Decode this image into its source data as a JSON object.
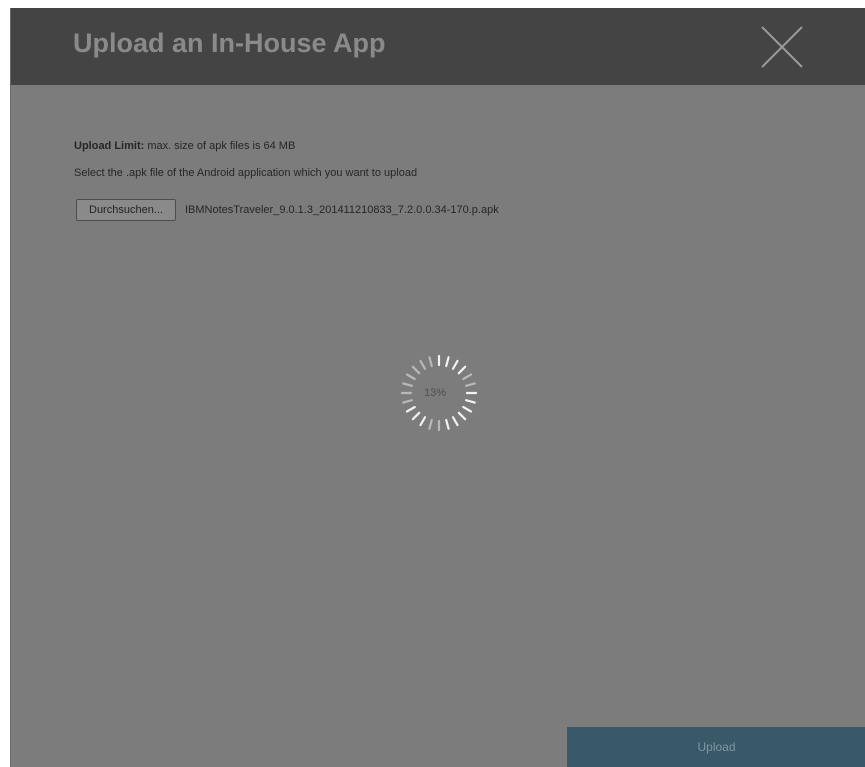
{
  "dialog": {
    "title": "Upload an In-House App",
    "close_icon": "close-x-icon",
    "upload_limit_label": "Upload Limit:",
    "upload_limit_text": "max. size of apk files is 64 MB",
    "instruction": "Select the .apk file of the Android application which you want to upload",
    "browse_label": "Durchsuchen...",
    "selected_file": "IBMNotesTraveler_9.0.1.3_201411210833_7.2.0.0.34-170.p.apk",
    "progress_text": "13%",
    "progress_value": 13,
    "spinner_icon": "loading-spinner-icon",
    "upload_label": "Upload"
  },
  "colors": {
    "titlebar": "#444444",
    "overlay": "#7c7c7c",
    "upload_button": "#395868"
  }
}
